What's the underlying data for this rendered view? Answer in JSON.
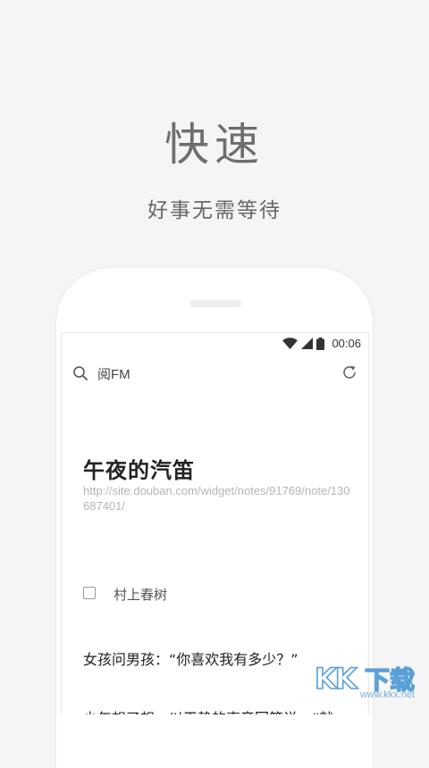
{
  "promo": {
    "headline": "快速",
    "subline": "好事无需等待"
  },
  "status_bar": {
    "time": "00:06",
    "icons": [
      "wifi-icon",
      "cell-signal-icon",
      "battery-icon"
    ]
  },
  "toolbar": {
    "search_icon": "search-icon",
    "title": "阅FM",
    "refresh_icon": "refresh-icon"
  },
  "article": {
    "title": "午夜的汽笛",
    "url": "http://site.douban.com/widget/notes/91769/note/130687401/",
    "author": "村上春树",
    "paragraph_1": "女孩问男孩：“你喜欢我有多少？”",
    "paragraph_2": "少年想了想，以平静的声音回答说：“就"
  },
  "watermark": {
    "logo_text": "KK下载",
    "site": "www.kkx.net"
  },
  "colors": {
    "background": "#f5f5f5",
    "phone_body": "#ffffff",
    "text_dark": "#222222",
    "url_gray": "#b5b5b5",
    "watermark_blue": "#5aa0d8"
  }
}
